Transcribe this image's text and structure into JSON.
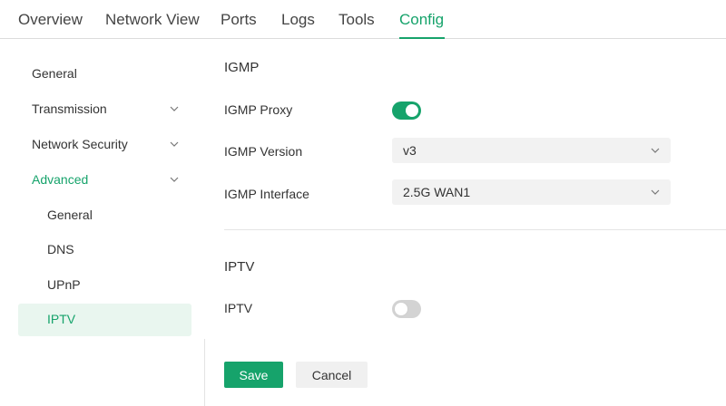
{
  "tabs": [
    {
      "label": "Overview"
    },
    {
      "label": "Network View"
    },
    {
      "label": "Ports"
    },
    {
      "label": "Logs"
    },
    {
      "label": "Tools"
    },
    {
      "label": "Config",
      "active": true
    }
  ],
  "sidebar": {
    "items": [
      {
        "label": "General"
      },
      {
        "label": "Transmission",
        "expandable": true
      },
      {
        "label": "Network Security",
        "expandable": true
      },
      {
        "label": "Advanced",
        "expandable": true,
        "expanded": true
      },
      {
        "label": "General"
      },
      {
        "label": "DNS"
      },
      {
        "label": "UPnP"
      },
      {
        "label": "IPTV",
        "selected": true
      }
    ]
  },
  "igmp": {
    "title": "IGMP",
    "proxy_label": "IGMP Proxy",
    "proxy_enabled": true,
    "version_label": "IGMP Version",
    "version_value": "v3",
    "interface_label": "IGMP Interface",
    "interface_value": "2.5G WAN1"
  },
  "iptv": {
    "title": "IPTV",
    "iptv_label": "IPTV",
    "iptv_enabled": false
  },
  "actions": {
    "save_label": "Save",
    "cancel_label": "Cancel"
  },
  "colors": {
    "accent": "#16a36b",
    "selected_bg": "#e9f6ef",
    "toggle_off": "#d3d3d3"
  }
}
